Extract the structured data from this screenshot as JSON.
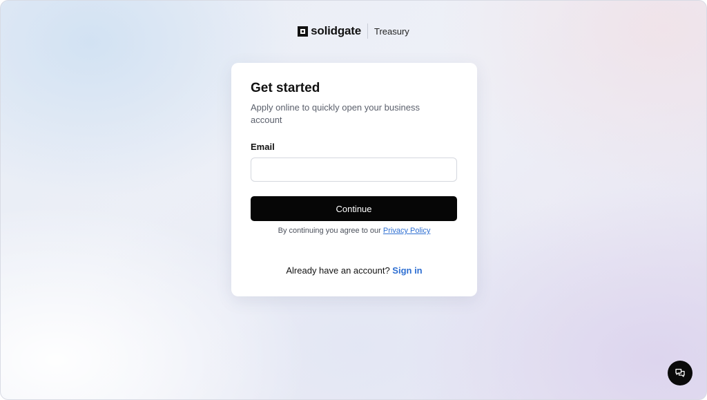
{
  "header": {
    "logo_text": "solidgate",
    "product": "Treasury"
  },
  "card": {
    "title": "Get started",
    "subtitle": "Apply online to quickly open your business account",
    "email": {
      "label": "Email",
      "value": "",
      "placeholder": ""
    },
    "continue_label": "Continue",
    "agree_text": "By continuing you agree to our ",
    "privacy_link": "Privacy Policy",
    "account_text": "Already have an account? ",
    "signin_link": "Sign in"
  },
  "chat": {
    "icon": "chat-icon"
  },
  "colors": {
    "link": "#2e6fd2",
    "button_bg": "#060606",
    "card_bg": "#ffffff"
  }
}
